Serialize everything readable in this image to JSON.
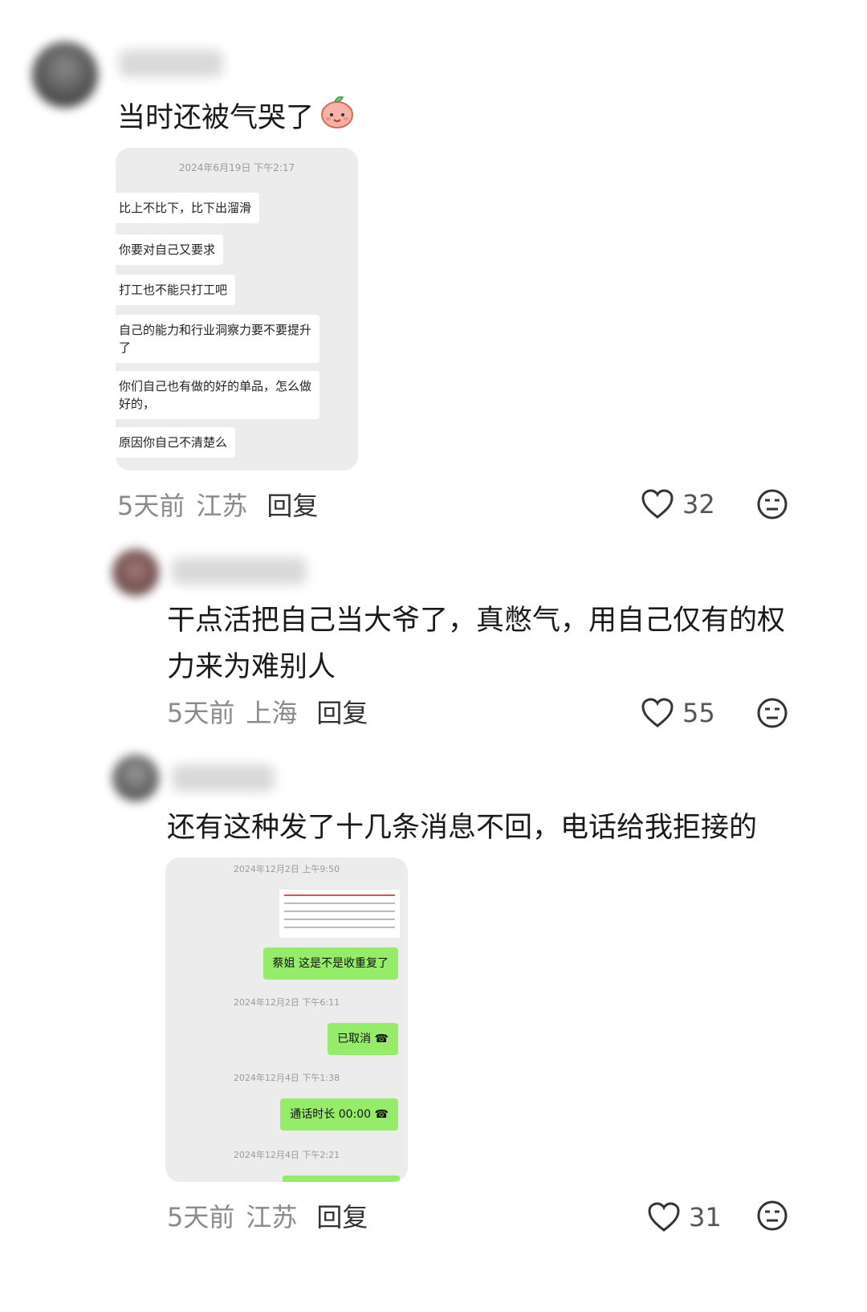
{
  "comments": [
    {
      "text": "当时还被气哭了",
      "emoji": "peach-face-icon",
      "time": "5天前",
      "location": "江苏",
      "reply": "回复",
      "likes": "32",
      "screenshot": {
        "timestamp": "2024年6月19日 下午2:17",
        "messages": [
          "比上不比下，比下出溜滑",
          "你要对自己又要求",
          "打工也不能只打工吧",
          "自己的能力和行业洞察力要不要提升了",
          "你们自己也有做的好的单品，怎么做好的，",
          "原因你自己不清楚么"
        ]
      }
    },
    {
      "text": "干点活把自己当大爷了，真憋气，用自己仅有的权力来为难别人",
      "time": "5天前",
      "location": "上海",
      "reply": "回复",
      "likes": "55"
    },
    {
      "text": "还有这种发了十几条消息不回，电话给我拒接的",
      "time": "5天前",
      "location": "江苏",
      "reply": "回复",
      "likes": "31",
      "screenshot": {
        "ts1": "2024年12月2日 上午9:50",
        "msg1": "蔡姐 这是不是收重复了",
        "ts2": "2024年12月2日 下午6:11",
        "msg2": "已取消",
        "ts3": "2024年12月4日 下午1:38",
        "msg3": "通话时长 00:00",
        "ts4": "2024年12月4日 下午2:21"
      }
    }
  ],
  "colors": {
    "wechat_green": "#95ec69",
    "meta_gray": "#8a8a8a"
  }
}
